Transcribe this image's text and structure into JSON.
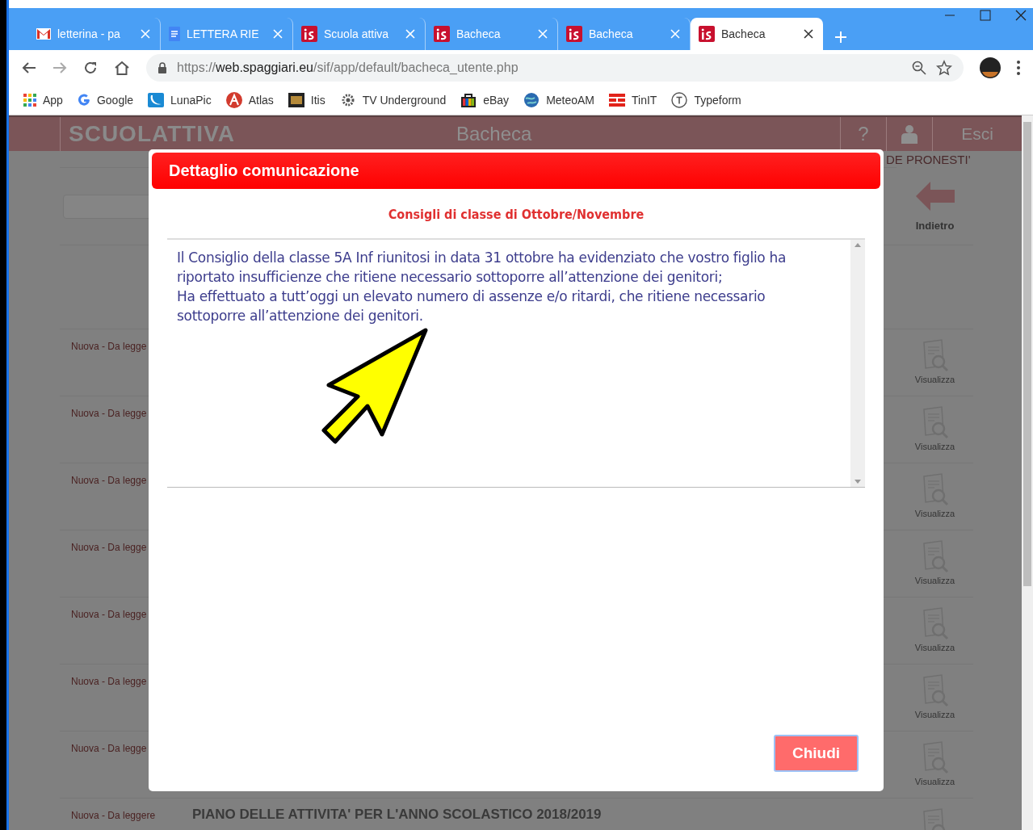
{
  "browser": {
    "tabs": [
      {
        "title": "letterina - pa",
        "kind": "mail",
        "selected": false
      },
      {
        "title": "LETTERA RIE",
        "kind": "doc",
        "selected": false
      },
      {
        "title": "Scuola attiva",
        "kind": "school",
        "selected": false
      },
      {
        "title": "Bacheca",
        "kind": "school",
        "selected": false
      },
      {
        "title": "Bacheca",
        "kind": "school",
        "selected": false
      },
      {
        "title": "Bacheca",
        "kind": "school",
        "selected": true
      }
    ],
    "url_scheme": "https://",
    "url_host": "web.spaggiari.eu",
    "url_path": "/sif/app/default/bacheca_utente.php",
    "bookmarks": [
      {
        "label": "App",
        "kind": "grid"
      },
      {
        "label": "Google",
        "kind": "g"
      },
      {
        "label": "LunaPic",
        "kind": "moon"
      },
      {
        "label": "Atlas",
        "kind": "letter"
      },
      {
        "label": "Itis",
        "kind": "square"
      },
      {
        "label": "TV Underground",
        "kind": "gear"
      },
      {
        "label": "eBay",
        "kind": "bag"
      },
      {
        "label": "MeteoAM",
        "kind": "globe"
      },
      {
        "label": "TinIT",
        "kind": "stripes"
      },
      {
        "label": "Typeform",
        "kind": "circle"
      }
    ]
  },
  "site": {
    "logo": "SCUOLATTIVA",
    "title": "Bacheca",
    "help": "?",
    "logout": "Esci",
    "user_name": "DE PRONESTI'",
    "back": "Indietro",
    "rows": [
      {
        "status": "Nuova - Da legge",
        "action": "Visualizza"
      },
      {
        "status": "Nuova - Da legge",
        "action": "Visualizza"
      },
      {
        "status": "Nuova - Da legge",
        "action": "Visualizza"
      },
      {
        "status": "Nuova - Da legge",
        "action": "Visualizza"
      },
      {
        "status": "Nuova - Da legge",
        "action": "Visualizza"
      },
      {
        "status": "Nuova - Da legge",
        "action": "Visualizza"
      },
      {
        "status": "Nuova - Da legge",
        "action": "Visualizza"
      },
      {
        "status": "Nuova - Da leggere",
        "title": "PIANO DELLE ATTIVITA' PER L'ANNO SCOLASTICO 2018/2019"
      }
    ]
  },
  "dialog": {
    "title": "Dettaglio comunicazione",
    "subject": "Consigli di classe di Ottobre/Novembre",
    "body": [
      "Il Consiglio della classe 5A Inf riunitosi in data 31 ottobre ha evidenziato che vostro figlio ha riportato insufficienze che ritiene necessario sottoporre all’attenzione dei genitori;",
      "Ha effettuato a tutt’oggi un elevato numero di assenze e/o ritardi, che ritiene necessario sottoporre all’attenzione dei genitori."
    ],
    "close": "Chiudi"
  }
}
